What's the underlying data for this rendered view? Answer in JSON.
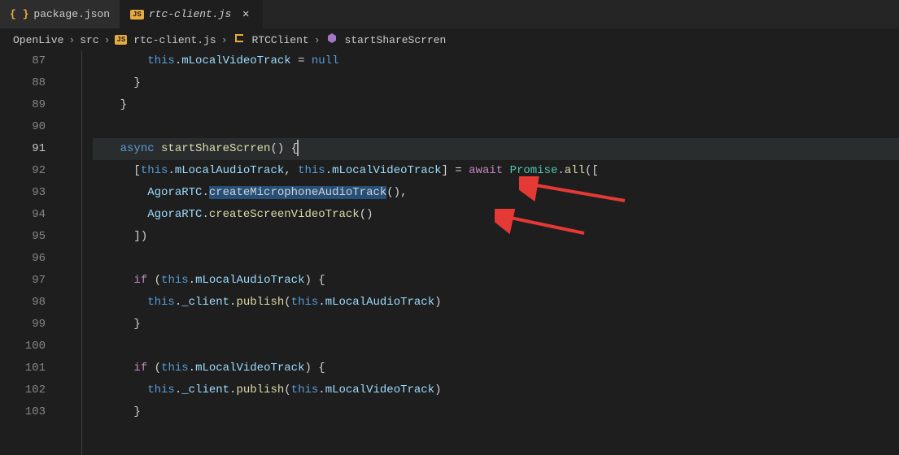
{
  "tabs": [
    {
      "label": "package.json",
      "iconType": "json",
      "active": false
    },
    {
      "label": "rtc-client.js",
      "iconType": "js",
      "active": true
    }
  ],
  "breadcrumb": {
    "items": [
      {
        "label": "OpenLive",
        "icon": null
      },
      {
        "label": "src",
        "icon": null
      },
      {
        "label": "rtc-client.js",
        "icon": "js"
      },
      {
        "label": "RTCClient",
        "icon": "class"
      },
      {
        "label": "startShareScrren",
        "icon": "method"
      }
    ]
  },
  "editor": {
    "gutter": [
      "87",
      "88",
      "89",
      "90",
      "91",
      "92",
      "93",
      "94",
      "95",
      "96",
      "97",
      "98",
      "99",
      "100",
      "101",
      "102",
      "103"
    ],
    "activeLineIndex": 4,
    "selection": {
      "line": 93,
      "text": "createMicrophoneAudioTrack"
    }
  },
  "tokens": {
    "this": "this",
    "mLocalVideoTrack": "mLocalVideoTrack",
    "mLocalAudioTrack": "mLocalAudioTrack",
    "null": "null",
    "async": "async",
    "startShareScrren": "startShareScrren",
    "await": "await",
    "Promise": "Promise",
    "all": "all",
    "AgoraRTC": "AgoraRTC",
    "createMicrophoneAudioTrack": "createMicrophoneAudioTrack",
    "createScreenVideoTrack": "createScreenVideoTrack",
    "if": "if",
    "_client": "_client",
    "publish": "publish"
  },
  "icons": {
    "json": "{ }",
    "js": "JS",
    "class": "◇",
    "method": "◈",
    "close": "✕",
    "chevron": "›"
  }
}
